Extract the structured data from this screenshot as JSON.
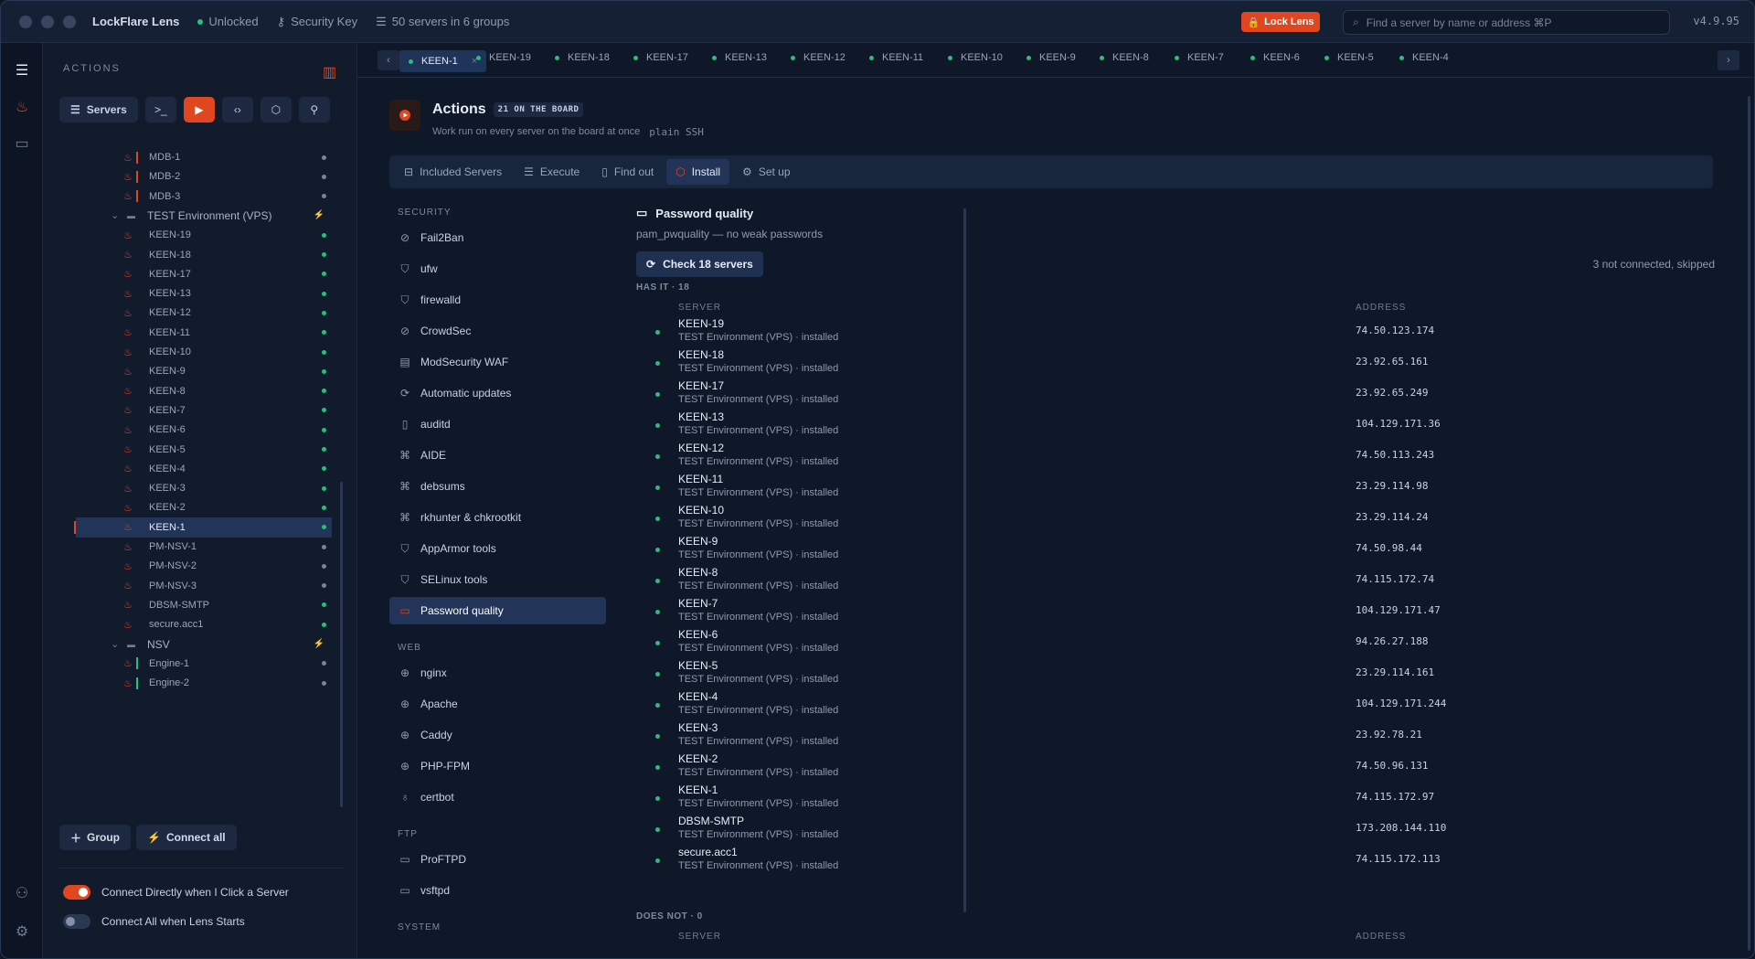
{
  "titlebar": {
    "app_name": "LockFlare Lens",
    "status": "Unlocked",
    "key": "Security Key",
    "servers_summary": "50 servers in 6 groups",
    "lock_label": "Lock Lens",
    "search_placeholder": "Find a server by name or address  ⌘P",
    "version": "v4.9.95"
  },
  "sidebar": {
    "title": "ACTIONS",
    "servers_label": "Servers",
    "tree": [
      {
        "name": "MDB-1",
        "bar": "#e0461f",
        "status": "#7a8599"
      },
      {
        "name": "MDB-2",
        "bar": "#e0461f",
        "status": "#7a8599"
      },
      {
        "name": "MDB-3",
        "bar": "#e0461f",
        "status": "#7a8599"
      },
      {
        "name": "TEST Environment (VPS)",
        "group": true
      },
      {
        "name": "KEEN-19",
        "status": "#22c27a"
      },
      {
        "name": "KEEN-18",
        "status": "#22c27a"
      },
      {
        "name": "KEEN-17",
        "status": "#22c27a"
      },
      {
        "name": "KEEN-13",
        "status": "#22c27a"
      },
      {
        "name": "KEEN-12",
        "status": "#22c27a"
      },
      {
        "name": "KEEN-11",
        "status": "#22c27a"
      },
      {
        "name": "KEEN-10",
        "status": "#22c27a"
      },
      {
        "name": "KEEN-9",
        "status": "#22c27a"
      },
      {
        "name": "KEEN-8",
        "status": "#22c27a"
      },
      {
        "name": "KEEN-7",
        "status": "#22c27a"
      },
      {
        "name": "KEEN-6",
        "status": "#22c27a"
      },
      {
        "name": "KEEN-5",
        "status": "#22c27a"
      },
      {
        "name": "KEEN-4",
        "status": "#22c27a"
      },
      {
        "name": "KEEN-3",
        "status": "#22c27a"
      },
      {
        "name": "KEEN-2",
        "status": "#22c27a"
      },
      {
        "name": "KEEN-1",
        "status": "#22c27a",
        "selected": true
      },
      {
        "name": "PM-NSV-1",
        "status": "#7a8599"
      },
      {
        "name": "PM-NSV-2",
        "status": "#7a8599"
      },
      {
        "name": "PM-NSV-3",
        "status": "#7a8599"
      },
      {
        "name": "DBSM-SMTP",
        "status": "#22c27a"
      },
      {
        "name": "secure.acc1",
        "status": "#22c27a"
      },
      {
        "name": "NSV",
        "group": true
      },
      {
        "name": "Engine-1",
        "bar": "#22c27a",
        "status": "#7a8599"
      },
      {
        "name": "Engine-2",
        "bar": "#22c27a",
        "status": "#7a8599"
      }
    ],
    "group_button": "Group",
    "connect_all_button": "Connect all",
    "toggle1": "Connect Directly when I Click a Server",
    "toggle2": "Connect All when Lens Starts"
  },
  "tabs": [
    "KEEN-1",
    "KEEN-19",
    "KEEN-18",
    "KEEN-17",
    "KEEN-13",
    "KEEN-12",
    "KEEN-11",
    "KEEN-10",
    "KEEN-9",
    "KEEN-8",
    "KEEN-7",
    "KEEN-6",
    "KEEN-5",
    "KEEN-4"
  ],
  "header": {
    "title": "Actions",
    "badge": "21 ON THE BOARD",
    "subtitle": "Work run on every server on the board at once",
    "subtitle_tag": "plain SSH"
  },
  "subtabs": [
    "Included Servers",
    "Execute",
    "Find out",
    "Install",
    "Set up"
  ],
  "categories": [
    {
      "section": "SECURITY",
      "items": [
        {
          "label": "Fail2Ban",
          "icon": "⊘"
        },
        {
          "label": "ufw",
          "icon": "⛉"
        },
        {
          "label": "firewalld",
          "icon": "⛉"
        },
        {
          "label": "CrowdSec",
          "icon": "⊘"
        },
        {
          "label": "ModSecurity WAF",
          "icon": "▤"
        },
        {
          "label": "Automatic updates",
          "icon": "⟳"
        },
        {
          "label": "auditd",
          "icon": "▯"
        },
        {
          "label": "AIDE",
          "icon": "⌘"
        },
        {
          "label": "debsums",
          "icon": "⌘"
        },
        {
          "label": "rkhunter & chkrootkit",
          "icon": "⌘"
        },
        {
          "label": "AppArmor tools",
          "icon": "⛉"
        },
        {
          "label": "SELinux tools",
          "icon": "⛉"
        },
        {
          "label": "Password quality",
          "icon": "▭",
          "active": true
        }
      ]
    },
    {
      "section": "WEB",
      "items": [
        {
          "label": "nginx",
          "icon": "⊕"
        },
        {
          "label": "Apache",
          "icon": "⊕"
        },
        {
          "label": "Caddy",
          "icon": "⊕"
        },
        {
          "label": "PHP-FPM",
          "icon": "⊕"
        },
        {
          "label": "certbot",
          "icon": "♁"
        }
      ]
    },
    {
      "section": "FTP",
      "items": [
        {
          "label": "ProFTPD",
          "icon": "▭"
        },
        {
          "label": "vsftpd",
          "icon": "▭"
        }
      ]
    },
    {
      "section": "SYSTEM",
      "items": []
    }
  ],
  "detail": {
    "title": "Password quality",
    "subtitle": "pam_pwquality — no weak passwords",
    "check_button": "Check 18 servers",
    "skipped": "3 not connected, skipped",
    "has_it_label": "HAS IT · 18",
    "does_not_label": "DOES NOT · 0",
    "col_server": "SERVER",
    "col_address": "ADDRESS",
    "servers": [
      {
        "name": "KEEN-19",
        "group": "TEST Environment (VPS) · installed",
        "address": "74.50.123.174"
      },
      {
        "name": "KEEN-18",
        "group": "TEST Environment (VPS) · installed",
        "address": "23.92.65.161"
      },
      {
        "name": "KEEN-17",
        "group": "TEST Environment (VPS) · installed",
        "address": "23.92.65.249"
      },
      {
        "name": "KEEN-13",
        "group": "TEST Environment (VPS) · installed",
        "address": "104.129.171.36"
      },
      {
        "name": "KEEN-12",
        "group": "TEST Environment (VPS) · installed",
        "address": "74.50.113.243"
      },
      {
        "name": "KEEN-11",
        "group": "TEST Environment (VPS) · installed",
        "address": "23.29.114.98"
      },
      {
        "name": "KEEN-10",
        "group": "TEST Environment (VPS) · installed",
        "address": "23.29.114.24"
      },
      {
        "name": "KEEN-9",
        "group": "TEST Environment (VPS) · installed",
        "address": "74.50.98.44"
      },
      {
        "name": "KEEN-8",
        "group": "TEST Environment (VPS) · installed",
        "address": "74.115.172.74"
      },
      {
        "name": "KEEN-7",
        "group": "TEST Environment (VPS) · installed",
        "address": "104.129.171.47"
      },
      {
        "name": "KEEN-6",
        "group": "TEST Environment (VPS) · installed",
        "address": "94.26.27.188"
      },
      {
        "name": "KEEN-5",
        "group": "TEST Environment (VPS) · installed",
        "address": "23.29.114.161"
      },
      {
        "name": "KEEN-4",
        "group": "TEST Environment (VPS) · installed",
        "address": "104.129.171.244"
      },
      {
        "name": "KEEN-3",
        "group": "TEST Environment (VPS) · installed",
        "address": "23.92.78.21"
      },
      {
        "name": "KEEN-2",
        "group": "TEST Environment (VPS) · installed",
        "address": "74.50.96.131"
      },
      {
        "name": "KEEN-1",
        "group": "TEST Environment (VPS) · installed",
        "address": "74.115.172.97"
      },
      {
        "name": "DBSM-SMTP",
        "group": "TEST Environment (VPS) · installed",
        "address": "173.208.144.110"
      },
      {
        "name": "secure.acc1",
        "group": "TEST Environment (VPS) · installed",
        "address": "74.115.172.113"
      }
    ]
  }
}
